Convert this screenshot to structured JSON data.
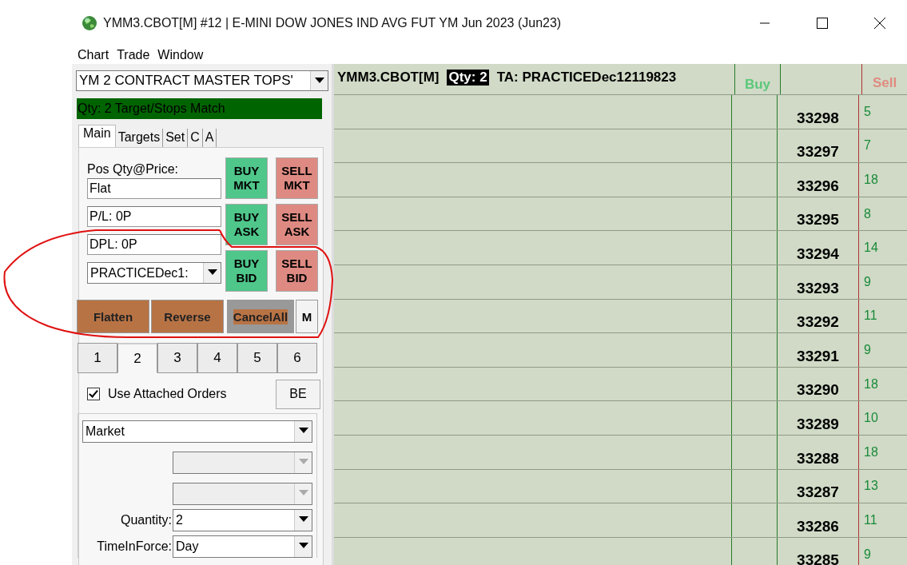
{
  "window": {
    "title": "YMM3.CBOT[M]  #12 | E-MINI DOW JONES IND AVG FUT YM Jun 2023 (Jun23)"
  },
  "menu": [
    "Chart",
    "Trade",
    "Window"
  ],
  "order_panel": {
    "template_select": "YM 2 CONTRACT MASTER TOPS'",
    "status_message": "Qty: 2 Target/Stops Match",
    "tabs": [
      {
        "label": "Main",
        "selected": true
      },
      {
        "label": "Targets",
        "selected": false
      },
      {
        "label": "Set",
        "selected": false
      },
      {
        "label": "C",
        "selected": false
      },
      {
        "label": "A",
        "selected": false
      }
    ],
    "position_label": "Pos Qty@Price:",
    "position_field": "Flat",
    "pl_field": "P/L: 0P",
    "dpl_field": "DPL: 0P",
    "account_select": "PRACTICEDec1:",
    "order_buttons": [
      {
        "label": "BUY MKT",
        "kind": "buy"
      },
      {
        "label": "SELL MKT",
        "kind": "sell"
      },
      {
        "label": "BUY ASK",
        "kind": "buy"
      },
      {
        "label": "SELL ASK",
        "kind": "sell"
      },
      {
        "label": "BUY BID",
        "kind": "buy"
      },
      {
        "label": "SELL BID",
        "kind": "sell"
      }
    ],
    "actions": [
      {
        "label": "Flatten",
        "kind": "warn"
      },
      {
        "label": "Reverse",
        "kind": "warn"
      },
      {
        "label": "CancelAll",
        "kind": "muted"
      },
      {
        "label": "M",
        "kind": "plain"
      }
    ],
    "strategy_tabs": [
      {
        "label": "1",
        "selected": false
      },
      {
        "label": "2",
        "selected": true
      },
      {
        "label": "3",
        "selected": false
      },
      {
        "label": "4",
        "selected": false
      },
      {
        "label": "5",
        "selected": false
      },
      {
        "label": "6",
        "selected": false
      }
    ],
    "use_attached_orders": {
      "label": "Use Attached Orders",
      "checked": true
    },
    "be_button": "BE",
    "order_type": "Market",
    "extra_selects": [
      {
        "disabled": true
      },
      {
        "disabled": true
      }
    ],
    "quantity": {
      "label": "Quantity:",
      "value": "2"
    },
    "time_in_force": {
      "label": "TimeInForce:",
      "value": "Day"
    }
  },
  "dom": {
    "symbol": "YMM3.CBOT[M]",
    "qty": "Qty: 2",
    "account": "TA: PRACTICEDec12119823",
    "buy_label": "Buy",
    "sell_label": "Sell",
    "rows": [
      {
        "price": "33298",
        "sell": "5"
      },
      {
        "price": "33297",
        "sell": "7"
      },
      {
        "price": "33296",
        "sell": "18"
      },
      {
        "price": "33295",
        "sell": "8"
      },
      {
        "price": "33294",
        "sell": "14"
      },
      {
        "price": "33293",
        "sell": "9"
      },
      {
        "price": "33292",
        "sell": "11"
      },
      {
        "price": "33291",
        "sell": "9"
      },
      {
        "price": "33290",
        "sell": "18"
      },
      {
        "price": "33289",
        "sell": "10"
      },
      {
        "price": "33288",
        "sell": "18"
      },
      {
        "price": "33287",
        "sell": "13"
      },
      {
        "price": "33286",
        "sell": "11"
      },
      {
        "price": "33285",
        "sell": "9"
      }
    ]
  }
}
